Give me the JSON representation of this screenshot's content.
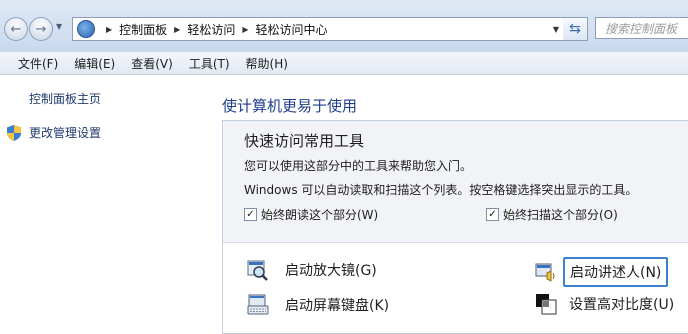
{
  "address": {
    "breadcrumb": [
      "控制面板",
      "轻松访问",
      "轻松访问中心"
    ],
    "search_placeholder": "搜索控制面板"
  },
  "menu": [
    "文件(F)",
    "编辑(E)",
    "查看(V)",
    "工具(T)",
    "帮助(H)"
  ],
  "sidebar": {
    "home": "控制面板主页",
    "admin": "更改管理设置"
  },
  "main": {
    "title": "使计算机更易于使用",
    "panel": {
      "heading": "快速访问常用工具",
      "line1": "您可以使用这部分中的工具来帮助您入门。",
      "line2": "Windows 可以自动读取和扫描这个列表。按空格键选择突出显示的工具。",
      "check_read": "始终朗读这个部分(W)",
      "check_scan": "始终扫描这个部分(O)"
    },
    "tools": {
      "magnifier": "启动放大镜(G)",
      "keyboard": "启动屏幕键盘(K)",
      "narrator": "启动讲述人(N)",
      "contrast": "设置高对比度(U)"
    }
  },
  "colors": {
    "link": "#1e3a6e",
    "title": "#1d3d8b",
    "focus": "#3d7fcf"
  }
}
